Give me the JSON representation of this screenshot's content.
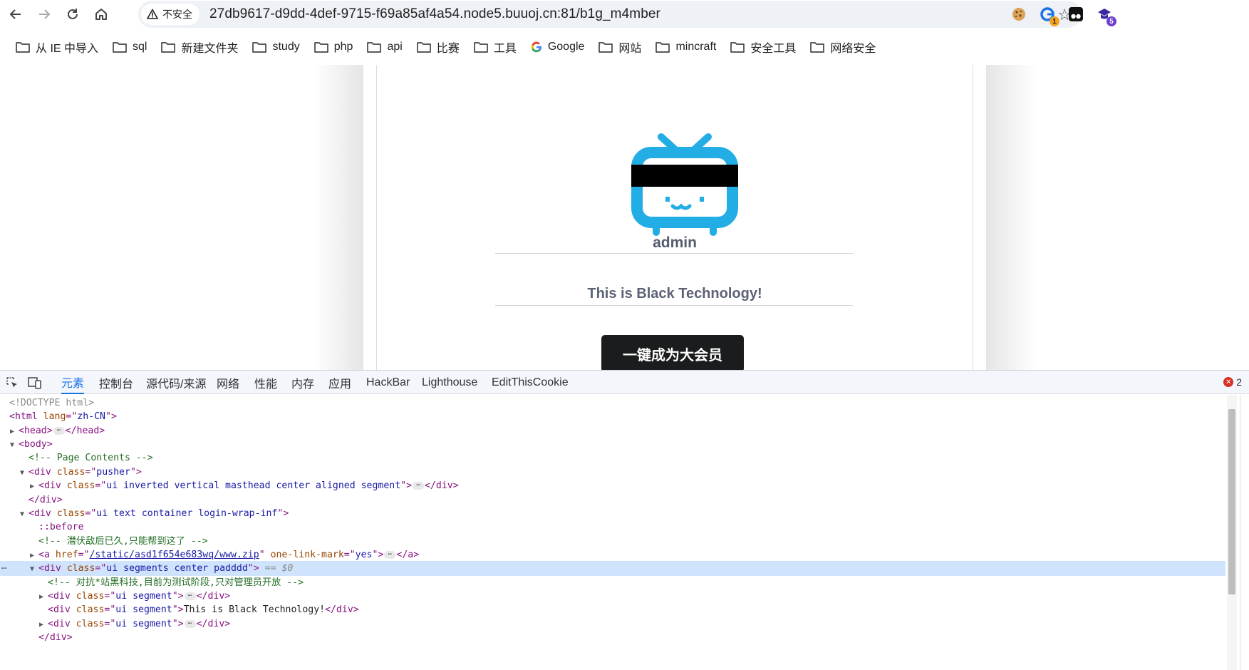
{
  "browser": {
    "security_label": "不安全",
    "url": "27db9617-d9dd-4def-9715-f69a85af4a54.node5.buuoj.cn:81/b1g_m4mber",
    "extensions": [
      {
        "name": "cookie-extension-icon",
        "badge": ""
      },
      {
        "name": "g-extension-icon",
        "badge": "1"
      },
      {
        "name": "tampermonkey-icon",
        "badge": ""
      },
      {
        "name": "cap-extension-icon",
        "badge": "5"
      }
    ],
    "colors": {
      "badge_orange": "#f4a321",
      "badge_purple": "#6b3fd1",
      "g_blue": "#1a73e8"
    }
  },
  "bookmarks": [
    {
      "label": "从 IE 中导入",
      "icon": "folder-icon"
    },
    {
      "label": "sql",
      "icon": "folder-icon"
    },
    {
      "label": "新建文件夹",
      "icon": "folder-icon"
    },
    {
      "label": "study",
      "icon": "folder-icon"
    },
    {
      "label": "php",
      "icon": "folder-icon"
    },
    {
      "label": "api",
      "icon": "folder-icon"
    },
    {
      "label": "比赛",
      "icon": "folder-icon"
    },
    {
      "label": "工具",
      "icon": "folder-icon"
    },
    {
      "label": "Google",
      "icon": "google-icon"
    },
    {
      "label": "网站",
      "icon": "folder-icon"
    },
    {
      "label": "mincraft",
      "icon": "folder-icon"
    },
    {
      "label": "安全工具",
      "icon": "folder-icon"
    },
    {
      "label": "网络安全",
      "icon": "folder-icon"
    }
  ],
  "page": {
    "username": "admin",
    "tagline": "This is Black Technology!",
    "button_label": "一键成为大会员",
    "colors": {
      "logo_blue": "#23ade5",
      "button_bg": "#1b1c1d"
    }
  },
  "devtools": {
    "tabs": [
      "元素",
      "控制台",
      "源代码/来源",
      "网络",
      "性能",
      "内存",
      "应用",
      "HackBar",
      "Lighthouse",
      "EditThisCookie"
    ],
    "active_tab": "元素",
    "error_count": "2",
    "dom": {
      "doctype": "<!DOCTYPE html>",
      "html_lang": "zh-CN",
      "comment_page_contents": "<!-- Page Contents -->",
      "pusher_class": "pusher",
      "masthead_class": "ui inverted vertical masthead center aligned segment",
      "login_class": "ui text container login-wrap-inf",
      "before": "::before",
      "comment_hint": "<!-- 潜伏敌后已久,只能帮到这了 -->",
      "a_href": "/static/asd1f654e683wq/www.zip",
      "a_attr_name": "one-link-mark",
      "a_attr_value": "yes",
      "segments_class": "ui segments center padddd",
      "selected_marker": "== $0",
      "comment_segments": "<!-- 对抗*站黑科技,目前为测试阶段,只对管理员开放 -->",
      "segment_class": "ui segment",
      "segment_text": "This is Black Technology!"
    }
  }
}
